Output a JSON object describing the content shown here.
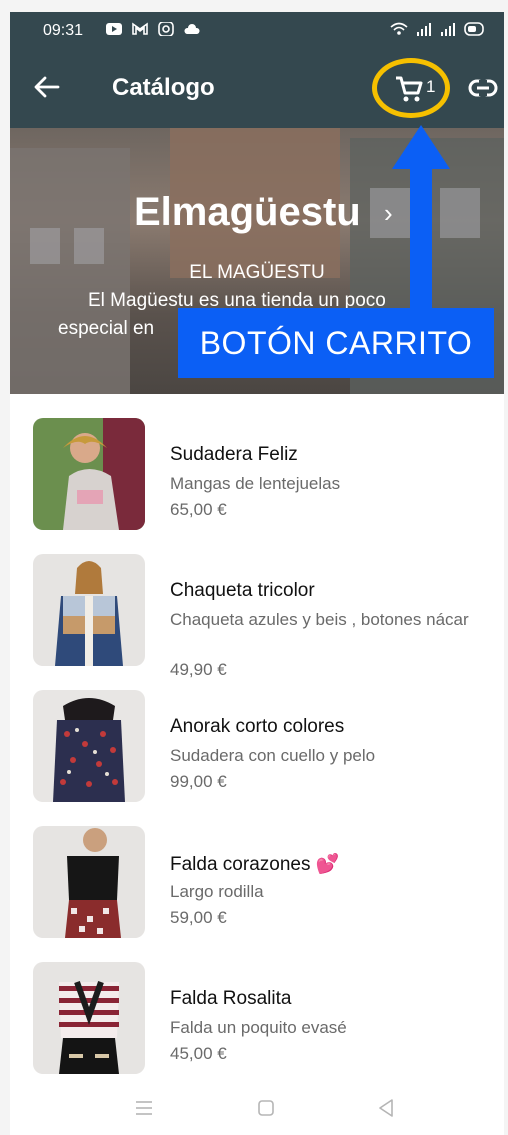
{
  "status_bar": {
    "time": "09:31",
    "left_icons": [
      "youtube-icon",
      "gmail-icon",
      "instagram-icon",
      "cloud-icon"
    ],
    "right_icons": [
      "wifi-icon",
      "signal-icon",
      "signal-icon",
      "battery-icon"
    ]
  },
  "app_bar": {
    "title": "Catálogo",
    "cart_count": "1",
    "icons": [
      "back-arrow-icon",
      "cart-icon",
      "link-icon"
    ],
    "highlight_color": "#f6c000"
  },
  "banner": {
    "store_name": "Elmagüestu",
    "line1": "EL MAGÜESTU",
    "line2": "El Magüestu es una tienda un poco",
    "line3": "especial en"
  },
  "annotation": {
    "label": "BOTÓN CARRITO",
    "color": "#0b5ff5"
  },
  "products": [
    {
      "name": "Sudadera Feliz",
      "description": "Mangas de lentejuelas",
      "price": "65,00 €"
    },
    {
      "name": "Chaqueta tricolor",
      "description": "Chaqueta azules y beis , botones nácar",
      "price": "49,90 €"
    },
    {
      "name": "Anorak corto colores",
      "description": "Sudadera con cuello y pelo",
      "price": "99,00 €"
    },
    {
      "name": "Falda corazones 💕",
      "description": "Largo rodilla",
      "price": "59,00 €"
    },
    {
      "name": "Falda Rosalita",
      "description": "Falda un poquito evasé",
      "price": "45,00 €"
    }
  ],
  "nav_bar": {
    "icons": [
      "menu-icon",
      "home-icon",
      "back-icon"
    ]
  },
  "colors": {
    "appbar": "#34484f",
    "price_gray": "#6a6a6a"
  }
}
